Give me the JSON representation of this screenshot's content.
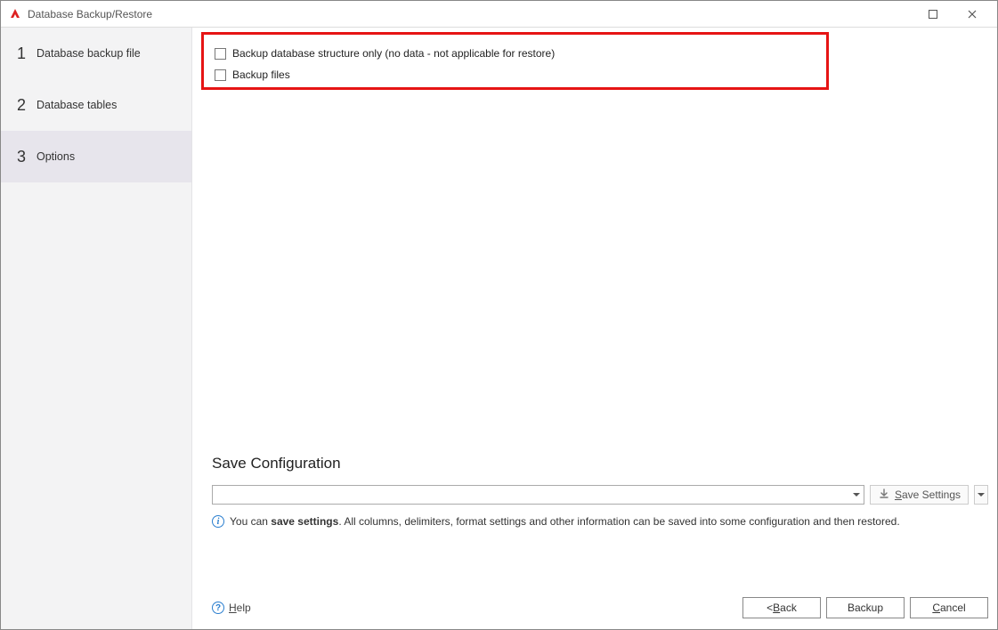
{
  "window": {
    "title": "Database Backup/Restore"
  },
  "sidebar": {
    "steps": [
      {
        "num": "1",
        "label": "Database backup file"
      },
      {
        "num": "2",
        "label": "Database tables"
      },
      {
        "num": "3",
        "label": "Options"
      }
    ],
    "activeIndex": 2
  },
  "options": {
    "cb1_label": "Backup database structure only (no data - not applicable for restore)",
    "cb2_label": "Backup files"
  },
  "saveConfig": {
    "title": "Save Configuration",
    "dropdown_value": "",
    "save_settings_label": "Save Settings",
    "info_prefix": "You can ",
    "info_bold": "save settings",
    "info_suffix": ". All columns, delimiters, format settings and other information can be saved into some configuration and then restored."
  },
  "footer": {
    "help_label": "Help",
    "back_label_prefix": "< ",
    "back_label_u": "B",
    "back_label_suffix": "ack",
    "backup_label": "Backup",
    "cancel_label_u": "C",
    "cancel_label_suffix": "ancel"
  }
}
